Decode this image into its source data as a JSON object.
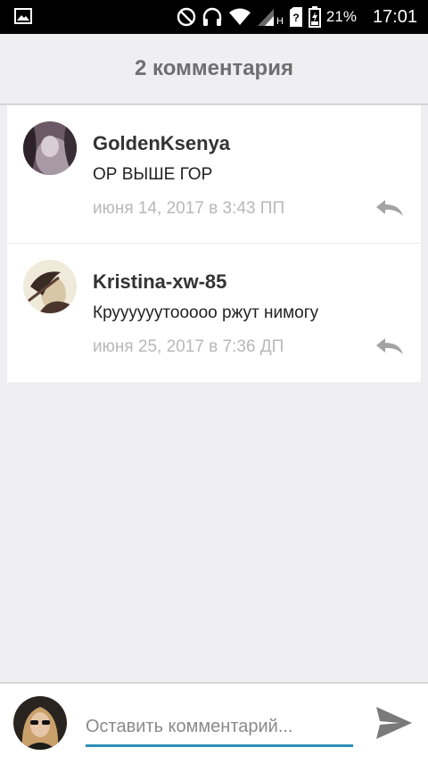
{
  "status_bar": {
    "icons": [
      "gallery-icon",
      "do-not-disturb-icon",
      "headphones-icon",
      "wifi-icon",
      "signal-icon",
      "network-type-h",
      "unknown-sim-icon",
      "battery-icon"
    ],
    "network_type": "H",
    "battery": "21%",
    "time": "17:01"
  },
  "header": {
    "title": "2 комментария"
  },
  "comments": [
    {
      "author": "GoldenKsenya",
      "text": "ОР ВЫШЕ ГОР",
      "date": "июня 14, 2017 в 3:43 ПП",
      "icon": "reply-icon"
    },
    {
      "author": "Kristina-xw-85",
      "text": "Круууууутооооо ржут нимогу",
      "date": "июня 25, 2017 в 7:36 ДП",
      "icon": "reply-icon"
    }
  ],
  "composer": {
    "placeholder": "Оставить комментарий...",
    "value": "",
    "send_icon": "send-icon"
  },
  "colors": {
    "background": "#efeef1",
    "status_bar": "#000000",
    "accent": "#2f8fb5",
    "date_text": "#b8b8b8"
  }
}
